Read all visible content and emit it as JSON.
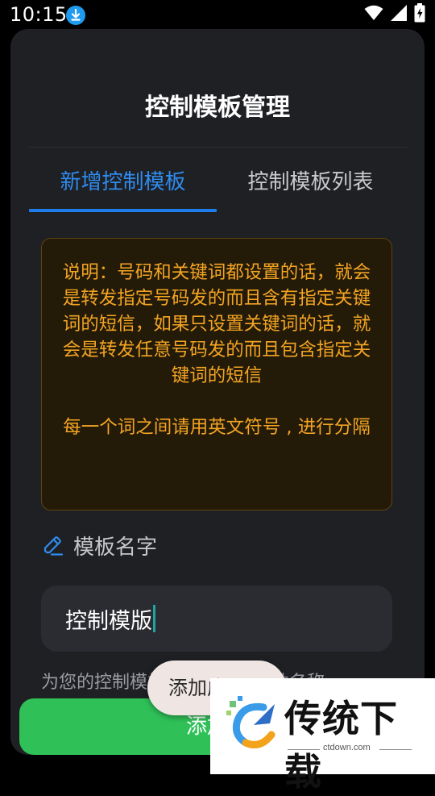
{
  "status_bar": {
    "time": "10:15",
    "icons": [
      "download-icon",
      "wifi-icon",
      "signal-icon",
      "battery-charging-icon"
    ]
  },
  "header": {
    "title": "控制模板管理"
  },
  "tabs": [
    {
      "label": "新增控制模板",
      "active": true
    },
    {
      "label": "控制模板列表",
      "active": false
    }
  ],
  "info": {
    "paragraph1": "说明：号码和关键词都设置的话，就会是转发指定号码发的而且含有指定关键词的短信，如果只设置关键词的话，就会是转发任意号码发的而且包含指定关键词的短信",
    "paragraph2": "每一个词之间请用英文符号 , 进行分隔"
  },
  "form": {
    "name_label": "模板名字",
    "name_value": "控制模版",
    "helper_text": "为您的控制模板设置一个描述性名称"
  },
  "actions": {
    "add_button_label": "添加"
  },
  "toast": {
    "text": "添加成功"
  },
  "watermark": {
    "brand": "传统下载",
    "domain": "ctdown.com"
  },
  "colors": {
    "accent_blue": "#2e8cf0",
    "info_text": "#f4a423",
    "button_green": "#2fc158",
    "card_bg": "#1f2024"
  }
}
